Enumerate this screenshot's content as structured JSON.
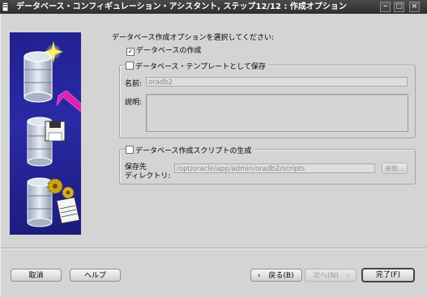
{
  "window": {
    "title": "データベース・コンフィギュレーション・アシスタント, ステップ12/12 : 作成オプション"
  },
  "main": {
    "prompt": "データベース作成オプションを選択してください:",
    "create_db": {
      "label": "データベースの作成",
      "checked": true
    },
    "save_template": {
      "label": "データベース・テンプレートとして保存",
      "checked": false,
      "name_label": "名前:",
      "name_value": "oradb2",
      "desc_label": "説明:"
    },
    "gen_scripts": {
      "label": "データベース作成スクリプトの生成",
      "checked": false,
      "dest_label_line1": "保存先",
      "dest_label_line2": "ディレクトリ:",
      "dest_value": "/opt/oracle/app/admin/oradb2/scripts",
      "browse_label": "参照..."
    }
  },
  "footer": {
    "cancel_label": "取消",
    "help_label": "ヘルプ",
    "back_label": "戻る(B)",
    "next_label": "次へ(N)",
    "finish_label": "完了(F)"
  }
}
